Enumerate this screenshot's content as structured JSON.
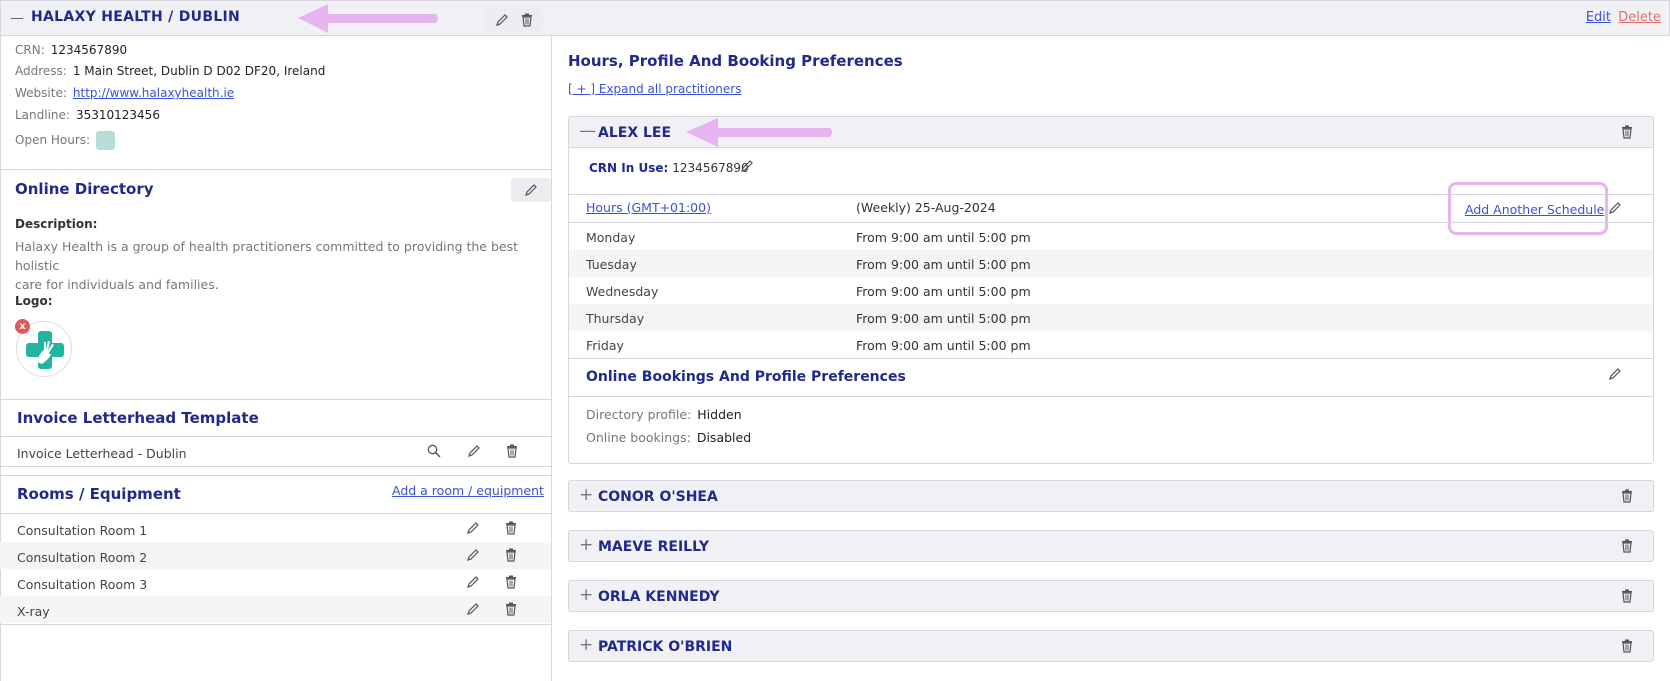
{
  "header": {
    "title": "HALAXY HEALTH / DUBLIN",
    "edit_label": "Edit",
    "delete_label": "Delete"
  },
  "clinic": {
    "crn_label": "CRN:",
    "crn_value": "1234567890",
    "address_label": "Address:",
    "address_value": "1 Main Street, Dublin D D02 DF20, Ireland",
    "website_label": "Website:",
    "website_value": "http://www.halaxyhealth.ie",
    "landline_label": "Landline:",
    "landline_value": "35310123456",
    "open_hours_label": "Open Hours:",
    "open_hours_color": "#b8dcd9"
  },
  "directory": {
    "title": "Online Directory",
    "description_label": "Description:",
    "description_line1": "Halaxy Health is a group of health practitioners committed to providing the best holistic",
    "description_line2": "care for individuals and families.",
    "logo_label": "Logo:",
    "logo_remove": "x"
  },
  "invoice": {
    "title": "Invoice Letterhead Template",
    "item": "Invoice Letterhead - Dublin"
  },
  "rooms": {
    "title": "Rooms / Equipment",
    "add_label": "Add a room / equipment",
    "items": [
      "Consultation Room 1",
      "Consultation Room 2",
      "Consultation Room 3",
      "X-ray"
    ]
  },
  "right": {
    "title": "Hours, Profile And Booking Preferences",
    "expand_label": "[ + ] Expand all practitioners"
  },
  "practitioner_open": {
    "name": "ALEX LEE",
    "crn_label": "CRN In Use:",
    "crn_value": "1234567890",
    "hours_link": "Hours (GMT+01:00)",
    "schedule_desc": "(Weekly) 25-Aug-2024",
    "add_schedule": "Add Another Schedule",
    "schedule": [
      {
        "day": "Monday",
        "time": "From 9:00 am until 5:00 pm"
      },
      {
        "day": "Tuesday",
        "time": "From 9:00 am until 5:00 pm"
      },
      {
        "day": "Wednesday",
        "time": "From 9:00 am until 5:00 pm"
      },
      {
        "day": "Thursday",
        "time": "From 9:00 am until 5:00 pm"
      },
      {
        "day": "Friday",
        "time": "From 9:00 am until 5:00 pm"
      }
    ],
    "prefs_title": "Online Bookings And Profile Preferences",
    "directory_profile_label": "Directory profile:",
    "directory_profile_value": "Hidden",
    "online_bookings_label": "Online bookings:",
    "online_bookings_value": "Disabled"
  },
  "practitioners_collapsed": [
    "CONOR O'SHEA",
    "MAEVE REILLY",
    "ORLA KENNEDY",
    "PATRICK O'BRIEN"
  ],
  "colors": {
    "navy": "#1f2a8c",
    "link": "#3b52d8",
    "delete": "#e36f6f",
    "highlight": "#e7b4f2"
  },
  "icons": {
    "pencil": "pencil-icon",
    "trash": "trash-icon",
    "search": "search-icon",
    "minus": "minus-icon",
    "plus": "plus-icon"
  }
}
